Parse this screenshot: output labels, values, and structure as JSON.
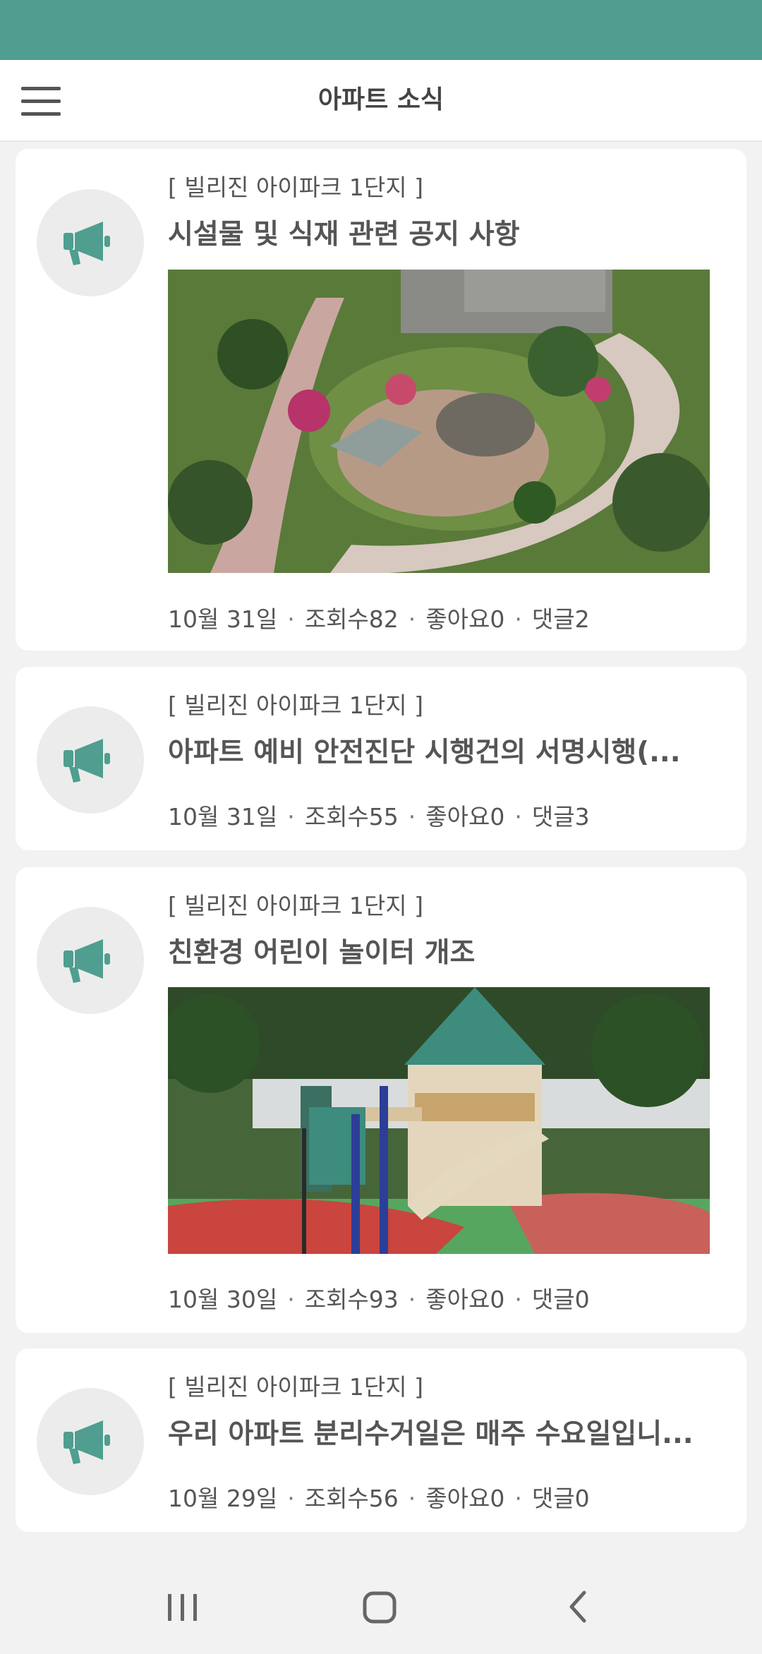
{
  "header": {
    "title": "아파트 소식"
  },
  "posts": [
    {
      "complex": "[ 빌리진 아이파크 1단지 ]",
      "title": "시설물 및 식재 관련 공지 사항",
      "date": "10월 31일",
      "views": "조회수82",
      "likes": "좋아요0",
      "comments": "댓글2",
      "image": "garden-fountain-photo"
    },
    {
      "complex": "[ 빌리진 아이파크 1단지 ]",
      "title": "아파트 예비 안전진단 시행건의 서명시행(...",
      "date": "10월 31일",
      "views": "조회수55",
      "likes": "좋아요0",
      "comments": "댓글3"
    },
    {
      "complex": "[ 빌리진 아이파크 1단지 ]",
      "title": "친환경 어린이 놀이터 개조",
      "date": "10월 30일",
      "views": "조회수93",
      "likes": "좋아요0",
      "comments": "댓글0",
      "image": "playground-photo"
    },
    {
      "complex": "[ 빌리진 아이파크 1단지 ]",
      "title": "우리 아파트 분리수거일은 매주 수요일입니...",
      "date": "10월 29일",
      "views": "조회수56",
      "likes": "좋아요0",
      "comments": "댓글0"
    }
  ],
  "separator": "·",
  "colors": {
    "accent": "#4f9e8f",
    "icon_bg": "#ececec",
    "text": "#555555"
  },
  "icons": {
    "post": "megaphone-icon",
    "menu": "hamburger-menu-icon"
  }
}
